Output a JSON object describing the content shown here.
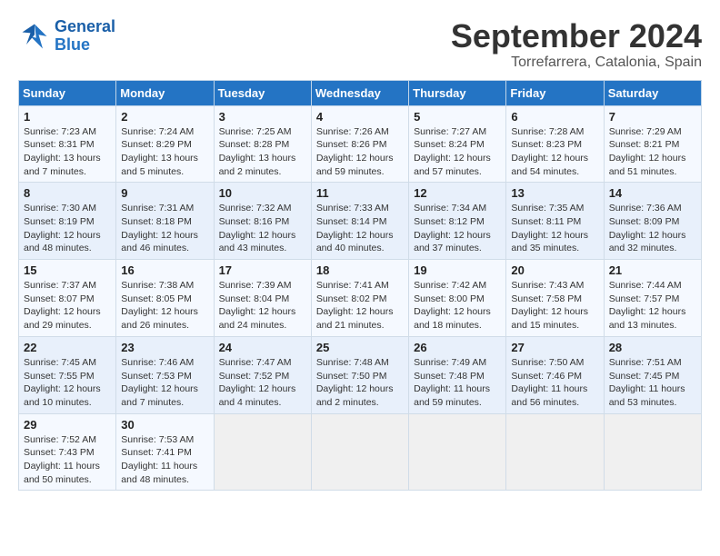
{
  "logo": {
    "line1": "General",
    "line2": "Blue"
  },
  "title": "September 2024",
  "subtitle": "Torrefarrera, Catalonia, Spain",
  "headers": [
    "Sunday",
    "Monday",
    "Tuesday",
    "Wednesday",
    "Thursday",
    "Friday",
    "Saturday"
  ],
  "weeks": [
    [
      {
        "num": "1",
        "detail": "Sunrise: 7:23 AM\nSunset: 8:31 PM\nDaylight: 13 hours\nand 7 minutes."
      },
      {
        "num": "2",
        "detail": "Sunrise: 7:24 AM\nSunset: 8:29 PM\nDaylight: 13 hours\nand 5 minutes."
      },
      {
        "num": "3",
        "detail": "Sunrise: 7:25 AM\nSunset: 8:28 PM\nDaylight: 13 hours\nand 2 minutes."
      },
      {
        "num": "4",
        "detail": "Sunrise: 7:26 AM\nSunset: 8:26 PM\nDaylight: 12 hours\nand 59 minutes."
      },
      {
        "num": "5",
        "detail": "Sunrise: 7:27 AM\nSunset: 8:24 PM\nDaylight: 12 hours\nand 57 minutes."
      },
      {
        "num": "6",
        "detail": "Sunrise: 7:28 AM\nSunset: 8:23 PM\nDaylight: 12 hours\nand 54 minutes."
      },
      {
        "num": "7",
        "detail": "Sunrise: 7:29 AM\nSunset: 8:21 PM\nDaylight: 12 hours\nand 51 minutes."
      }
    ],
    [
      {
        "num": "8",
        "detail": "Sunrise: 7:30 AM\nSunset: 8:19 PM\nDaylight: 12 hours\nand 48 minutes."
      },
      {
        "num": "9",
        "detail": "Sunrise: 7:31 AM\nSunset: 8:18 PM\nDaylight: 12 hours\nand 46 minutes."
      },
      {
        "num": "10",
        "detail": "Sunrise: 7:32 AM\nSunset: 8:16 PM\nDaylight: 12 hours\nand 43 minutes."
      },
      {
        "num": "11",
        "detail": "Sunrise: 7:33 AM\nSunset: 8:14 PM\nDaylight: 12 hours\nand 40 minutes."
      },
      {
        "num": "12",
        "detail": "Sunrise: 7:34 AM\nSunset: 8:12 PM\nDaylight: 12 hours\nand 37 minutes."
      },
      {
        "num": "13",
        "detail": "Sunrise: 7:35 AM\nSunset: 8:11 PM\nDaylight: 12 hours\nand 35 minutes."
      },
      {
        "num": "14",
        "detail": "Sunrise: 7:36 AM\nSunset: 8:09 PM\nDaylight: 12 hours\nand 32 minutes."
      }
    ],
    [
      {
        "num": "15",
        "detail": "Sunrise: 7:37 AM\nSunset: 8:07 PM\nDaylight: 12 hours\nand 29 minutes."
      },
      {
        "num": "16",
        "detail": "Sunrise: 7:38 AM\nSunset: 8:05 PM\nDaylight: 12 hours\nand 26 minutes."
      },
      {
        "num": "17",
        "detail": "Sunrise: 7:39 AM\nSunset: 8:04 PM\nDaylight: 12 hours\nand 24 minutes."
      },
      {
        "num": "18",
        "detail": "Sunrise: 7:41 AM\nSunset: 8:02 PM\nDaylight: 12 hours\nand 21 minutes."
      },
      {
        "num": "19",
        "detail": "Sunrise: 7:42 AM\nSunset: 8:00 PM\nDaylight: 12 hours\nand 18 minutes."
      },
      {
        "num": "20",
        "detail": "Sunrise: 7:43 AM\nSunset: 7:58 PM\nDaylight: 12 hours\nand 15 minutes."
      },
      {
        "num": "21",
        "detail": "Sunrise: 7:44 AM\nSunset: 7:57 PM\nDaylight: 12 hours\nand 13 minutes."
      }
    ],
    [
      {
        "num": "22",
        "detail": "Sunrise: 7:45 AM\nSunset: 7:55 PM\nDaylight: 12 hours\nand 10 minutes."
      },
      {
        "num": "23",
        "detail": "Sunrise: 7:46 AM\nSunset: 7:53 PM\nDaylight: 12 hours\nand 7 minutes."
      },
      {
        "num": "24",
        "detail": "Sunrise: 7:47 AM\nSunset: 7:52 PM\nDaylight: 12 hours\nand 4 minutes."
      },
      {
        "num": "25",
        "detail": "Sunrise: 7:48 AM\nSunset: 7:50 PM\nDaylight: 12 hours\nand 2 minutes."
      },
      {
        "num": "26",
        "detail": "Sunrise: 7:49 AM\nSunset: 7:48 PM\nDaylight: 11 hours\nand 59 minutes."
      },
      {
        "num": "27",
        "detail": "Sunrise: 7:50 AM\nSunset: 7:46 PM\nDaylight: 11 hours\nand 56 minutes."
      },
      {
        "num": "28",
        "detail": "Sunrise: 7:51 AM\nSunset: 7:45 PM\nDaylight: 11 hours\nand 53 minutes."
      }
    ],
    [
      {
        "num": "29",
        "detail": "Sunrise: 7:52 AM\nSunset: 7:43 PM\nDaylight: 11 hours\nand 50 minutes."
      },
      {
        "num": "30",
        "detail": "Sunrise: 7:53 AM\nSunset: 7:41 PM\nDaylight: 11 hours\nand 48 minutes."
      },
      {
        "num": "",
        "detail": ""
      },
      {
        "num": "",
        "detail": ""
      },
      {
        "num": "",
        "detail": ""
      },
      {
        "num": "",
        "detail": ""
      },
      {
        "num": "",
        "detail": ""
      }
    ]
  ]
}
